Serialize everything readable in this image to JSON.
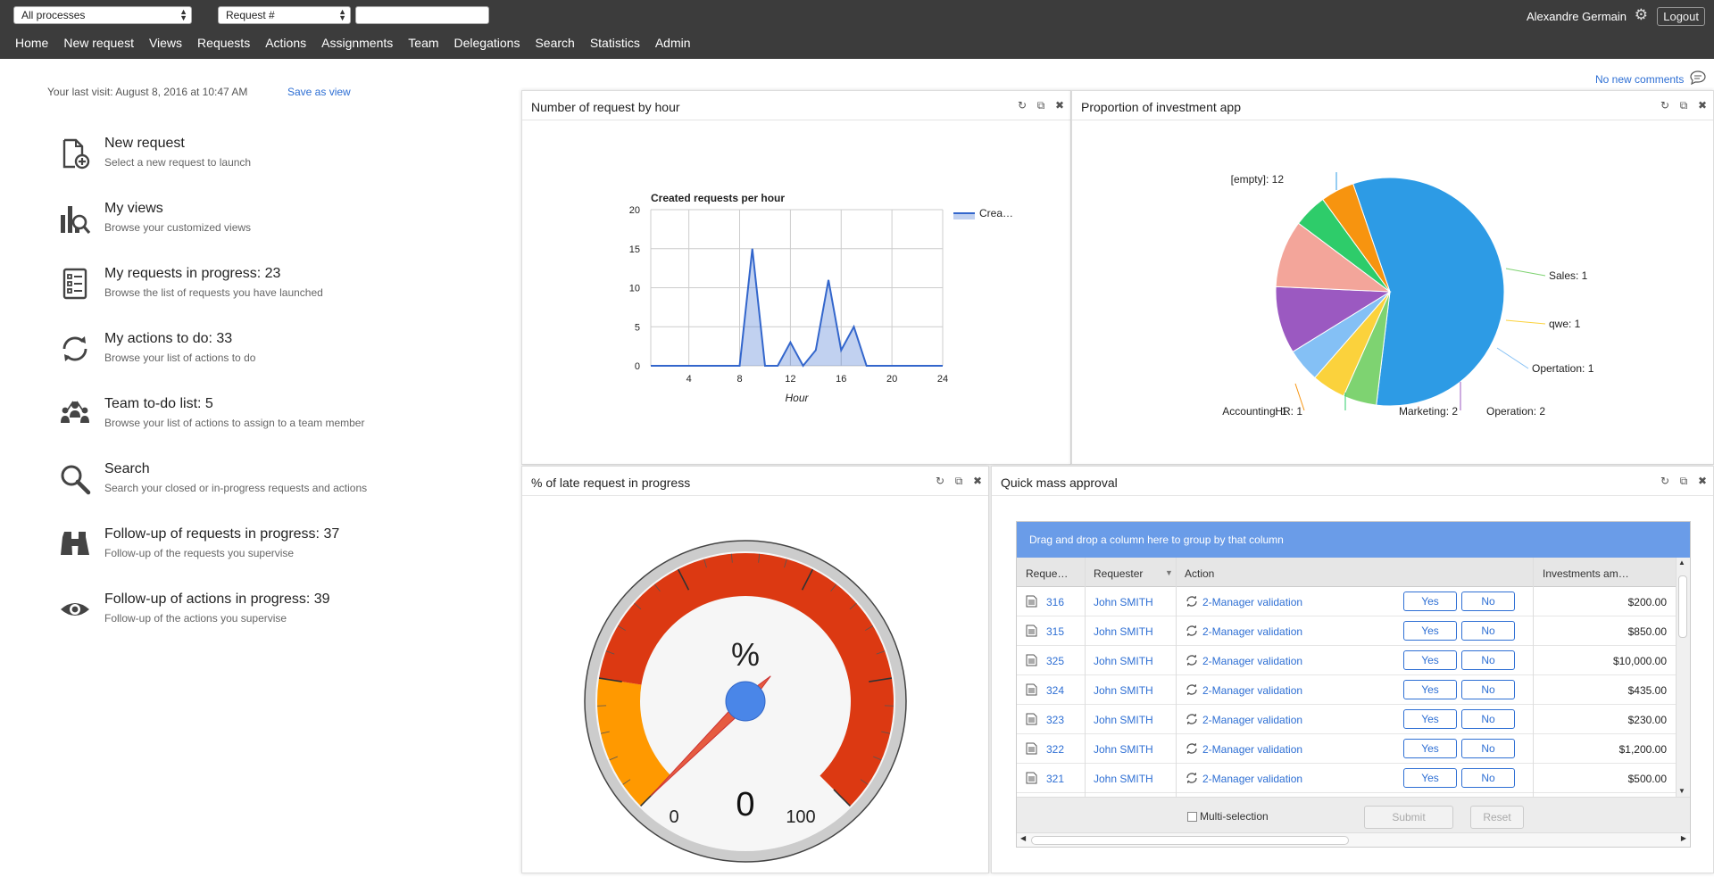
{
  "topbar": {
    "process_select": "All processes",
    "request_select": "Request #",
    "request_input_value": "",
    "user_name": "Alexandre Germain",
    "logout_label": "Logout"
  },
  "nav": [
    "Home",
    "New request",
    "Views",
    "Requests",
    "Actions",
    "Assignments",
    "Team",
    "Delegations",
    "Search",
    "Statistics",
    "Admin"
  ],
  "home": {
    "last_visit": "Your last visit: August 8, 2016 at 10:47 AM",
    "save_as_view": "Save as view",
    "no_comments": "No new comments",
    "menu": [
      {
        "title": "New request",
        "subtitle": "Select a new request to launch",
        "icon": "new-request-icon"
      },
      {
        "title": "My views",
        "subtitle": "Browse your customized views",
        "icon": "views-icon"
      },
      {
        "title": "My requests in progress: 23",
        "subtitle": "Browse the list of requests you have launched",
        "icon": "list-icon"
      },
      {
        "title": "My actions to do: 33",
        "subtitle": "Browse your list of actions to do",
        "icon": "refresh-icon"
      },
      {
        "title": "Team to-do list: 5",
        "subtitle": "Browse your list of actions to assign to a team member",
        "icon": "team-icon"
      },
      {
        "title": "Search",
        "subtitle": "Search your closed or in-progress requests and actions",
        "icon": "search-icon"
      },
      {
        "title": "Follow-up of requests in progress: 37",
        "subtitle": "Follow-up of the requests you supervise",
        "icon": "binoculars-icon"
      },
      {
        "title": "Follow-up of actions in progress: 39",
        "subtitle": "Follow-up of the actions you supervise",
        "icon": "eye-icon"
      }
    ]
  },
  "panels": {
    "hour": {
      "title": "Number of request by hour"
    },
    "prop": {
      "title": "Proportion of investment app"
    },
    "late": {
      "title": "% of late request in progress"
    },
    "quick": {
      "title": "Quick mass approval"
    }
  },
  "chart_data": [
    {
      "type": "area",
      "title": "Created requests per hour",
      "xlabel": "Hour",
      "ylabel": "",
      "xlim": [
        1,
        24
      ],
      "ylim": [
        0,
        20
      ],
      "xticks": [
        4,
        8,
        12,
        16,
        20,
        24
      ],
      "yticks": [
        0,
        5,
        10,
        15,
        20
      ],
      "grid": true,
      "legend": "right",
      "series": [
        {
          "name": "Crea…",
          "color": "#3366cc",
          "x": [
            1,
            2,
            3,
            4,
            5,
            6,
            7,
            8,
            9,
            10,
            11,
            12,
            13,
            14,
            15,
            16,
            17,
            18,
            19,
            20,
            21,
            22,
            23,
            24
          ],
          "values": [
            0,
            0,
            0,
            0,
            0,
            0,
            0,
            0,
            15,
            0,
            0,
            3,
            0,
            2,
            11,
            2,
            5,
            0,
            0,
            0,
            0,
            0,
            0,
            0
          ]
        }
      ]
    },
    {
      "type": "pie",
      "title": "",
      "legend": "labels",
      "slices": [
        {
          "label": "[empty]: 12",
          "value": 12,
          "color": "#2d9be5"
        },
        {
          "label": "Sales: 1",
          "value": 1,
          "color": "#7ed371"
        },
        {
          "label": "qwe: 1",
          "value": 1,
          "color": "#fbd23c"
        },
        {
          "label": "Opertation: 1",
          "value": 1,
          "color": "#84c0f5"
        },
        {
          "label": "Operation: 2",
          "value": 2,
          "color": "#9b59c1"
        },
        {
          "label": "Marketing: 2",
          "value": 2,
          "color": "#f3a59a"
        },
        {
          "label": "HR: 1",
          "value": 1,
          "color": "#2ecc6a"
        },
        {
          "label": "Accounting: 1",
          "value": 1,
          "color": "#f7940f"
        }
      ]
    },
    {
      "type": "gauge",
      "title": "%",
      "min": 0,
      "max": 100,
      "value": 0,
      "min_label": "0",
      "max_label": "100",
      "value_label": "0",
      "bands": [
        {
          "from": 0,
          "to": 20,
          "color": "#ff9900"
        },
        {
          "from": 20,
          "to": 100,
          "color": "#dc3912"
        }
      ]
    }
  ],
  "grid": {
    "group_hint": "Drag and drop a column here to group by that column",
    "columns": [
      "Reque…",
      "Requester",
      "Action",
      "Investments am…"
    ],
    "yes_label": "Yes",
    "no_label": "No",
    "rows": [
      {
        "id": "316",
        "requester": "John SMITH",
        "action": "2-Manager validation",
        "amount": "$200.00"
      },
      {
        "id": "315",
        "requester": "John SMITH",
        "action": "2-Manager validation",
        "amount": "$850.00"
      },
      {
        "id": "325",
        "requester": "John SMITH",
        "action": "2-Manager validation",
        "amount": "$10,000.00"
      },
      {
        "id": "324",
        "requester": "John SMITH",
        "action": "2-Manager validation",
        "amount": "$435.00"
      },
      {
        "id": "323",
        "requester": "John SMITH",
        "action": "2-Manager validation",
        "amount": "$230.00"
      },
      {
        "id": "322",
        "requester": "John SMITH",
        "action": "2-Manager validation",
        "amount": "$1,200.00"
      },
      {
        "id": "321",
        "requester": "John SMITH",
        "action": "2-Manager validation",
        "amount": "$500.00"
      }
    ],
    "multi_selection": "Multi-selection",
    "submit_label": "Submit",
    "reset_label": "Reset"
  }
}
